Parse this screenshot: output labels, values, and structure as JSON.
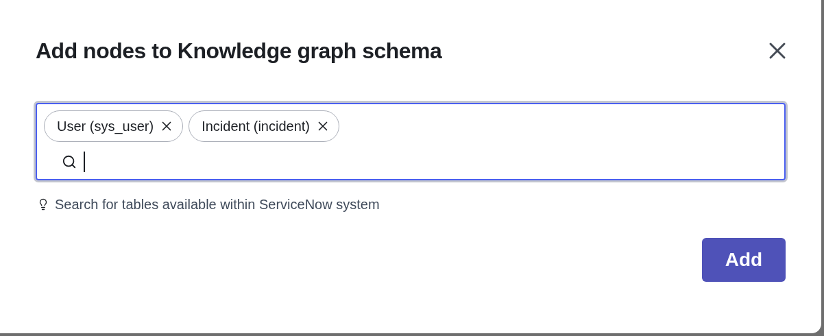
{
  "dialog": {
    "title": "Add nodes to Knowledge graph schema"
  },
  "table_picker": {
    "focused": true,
    "chips": [
      {
        "label": "User (sys_user)"
      },
      {
        "label": "Incident (incident)"
      }
    ],
    "hint": "Search for tables available within ServiceNow system"
  },
  "buttons": [
    {
      "kind": "primary",
      "label": "Add"
    }
  ]
}
